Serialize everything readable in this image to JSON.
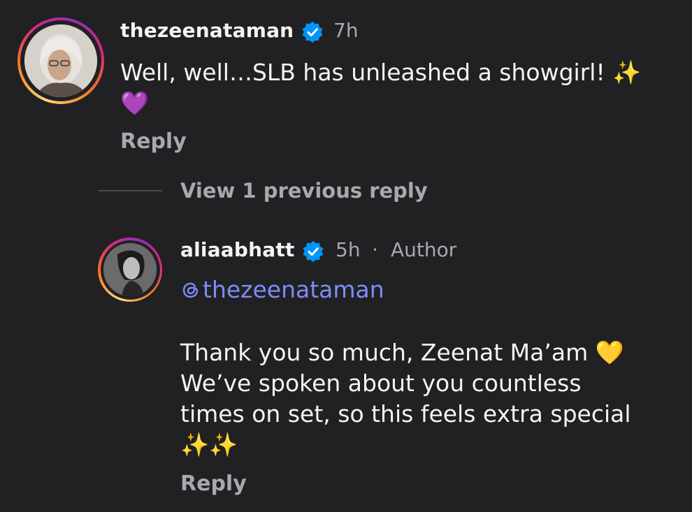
{
  "comments": [
    {
      "username": "thezeenataman",
      "time": "7h",
      "line1": "Well, well…SLB has unleashed a showgirl! ✨",
      "line2": "💜",
      "reply_label": "Reply"
    },
    {
      "username": "aliaabhatt",
      "time": "5h",
      "separator": "·",
      "author_badge": "Author",
      "mention": "thezeenataman",
      "line1": "Thank you so much, Zeenat Ma’am 💛",
      "line2": "We’ve spoken about you countless",
      "line3": "times on set, so this feels extra special",
      "line4": "✨✨",
      "reply_label": "Reply"
    }
  ],
  "view_replies_label": "View 1 previous reply",
  "colors": {
    "background": "#212124",
    "text_primary": "#f4f4f5",
    "text_secondary": "#a8a8ad",
    "mention": "#7e8cf8",
    "verified": "#0095f6"
  },
  "icons": {
    "verified": "verified-badge-icon",
    "mention_prefix": "threads-icon"
  }
}
